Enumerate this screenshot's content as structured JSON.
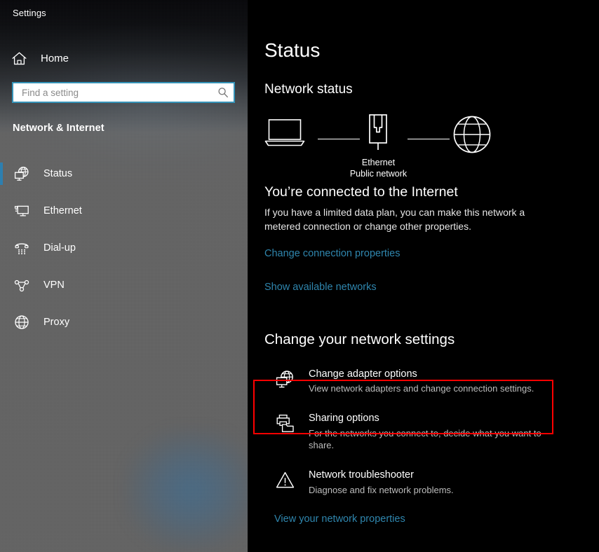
{
  "window": {
    "app_title": "Settings"
  },
  "sidebar": {
    "home": {
      "label": "Home",
      "icon": "home-icon"
    },
    "search": {
      "value": "",
      "placeholder": "Find a setting",
      "icon": "search-icon"
    },
    "category_title": "Network & Internet",
    "items": [
      {
        "label": "Status",
        "icon": "network-status-icon",
        "selected": true
      },
      {
        "label": "Ethernet",
        "icon": "ethernet-monitor-icon",
        "selected": false
      },
      {
        "label": "Dial-up",
        "icon": "telephone-icon",
        "selected": false
      },
      {
        "label": "VPN",
        "icon": "vpn-nodes-icon",
        "selected": false
      },
      {
        "label": "Proxy",
        "icon": "globe-icon",
        "selected": false
      }
    ]
  },
  "main": {
    "page_title": "Status",
    "network_status_heading": "Network status",
    "diagram": {
      "device_icon": "laptop-icon",
      "adapter_icon": "ethernet-port-icon",
      "internet_icon": "globe-icon",
      "adapter_name": "Ethernet",
      "network_type": "Public network"
    },
    "connection_title": "You’re connected to the Internet",
    "connection_desc": "If you have a limited data plan, you can make this network a metered connection or change other properties.",
    "link_change_connection": "Change connection properties",
    "link_show_networks": "Show available networks",
    "change_settings_heading": "Change your network settings",
    "options": [
      {
        "title": "Change adapter options",
        "desc": "View network adapters and change connection settings.",
        "icon": "network-adapter-icon",
        "highlighted": true
      },
      {
        "title": "Sharing options",
        "desc": "For the networks you connect to, decide what you want to share.",
        "icon": "sharing-printer-folder-icon",
        "highlighted": false
      },
      {
        "title": "Network troubleshooter",
        "desc": "Diagnose and fix network problems.",
        "icon": "warning-triangle-icon",
        "highlighted": false
      }
    ],
    "link_view_properties": "View your network properties"
  },
  "colors": {
    "accent_link": "#2f86ae",
    "selection_bar": "#2d7fb0",
    "search_border": "#3593b8",
    "highlight_box": "#ff0000",
    "sidebar_bg": "#636363",
    "main_bg": "#000000"
  }
}
